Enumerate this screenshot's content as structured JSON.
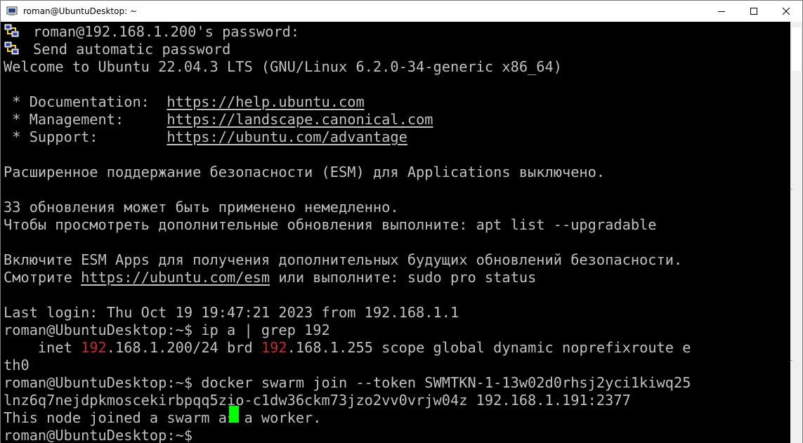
{
  "window": {
    "title": "roman@UbuntuDesktop: ~",
    "icon": "putty-terminal-icon",
    "controls": {
      "minimize": "minimize-icon",
      "maximize": "maximize-icon",
      "close": "close-icon"
    }
  },
  "colors": {
    "background": "#000000",
    "text": "#c0c0c0",
    "highlight_red": "#c42b2b",
    "cursor": "#00ff00"
  },
  "terminal": {
    "putty_lines": [
      "roman@192.168.1.200's password:",
      "Send automatic password"
    ],
    "welcome": "Welcome to Ubuntu 22.04.3 LTS (GNU/Linux 6.2.0-34-generic x86_64)",
    "links": [
      {
        "label": " * Documentation:  ",
        "url": "https://help.ubuntu.com"
      },
      {
        "label": " * Management:     ",
        "url": "https://landscape.canonical.com"
      },
      {
        "label": " * Support:        ",
        "url": "https://ubuntu.com/advantage"
      }
    ],
    "esm_notice": "Расширенное поддержание безопасности (ESM) для Applications выключено.",
    "updates_count": "33 обновления может быть применено немедленно.",
    "updates_hint": "Чтобы просмотреть дополнительные обновления выполните: apt list --upgradable",
    "esm_enable": "Включите ESM Apps для получения дополнительных будущих обновлений безопасности.",
    "esm_see_prefix": "Смотрите ",
    "esm_see_url": "https://ubuntu.com/esm",
    "esm_see_suffix": " или выполните: sudo pro status",
    "last_login": "Last login: Thu Oct 19 19:47:21 2023 from 192.168.1.1",
    "cmd1": "roman@UbuntuDesktop:~$ ip a | grep 192",
    "inet_line": {
      "p1": "    inet ",
      "m1": "192",
      "p2": ".168.1.200/24 brd ",
      "m2": "192",
      "p3": ".168.1.255 scope global dynamic noprefixroute e"
    },
    "inet_wrap": "th0",
    "cmd2": "roman@UbuntuDesktop:~$ docker swarm join --token SWMTKN-1-13w02d0rhsj2yci1kiwq25",
    "cmd2_wrap": "lnz6q7nejdpkmoscekirbpqq5zio-c1dw36ckm73jzo2vv0vrjw04z 192.168.1.191:2377",
    "swarm_result": "This node joined a swarm as a worker.",
    "prompt": "roman@UbuntuDesktop:~$ "
  }
}
